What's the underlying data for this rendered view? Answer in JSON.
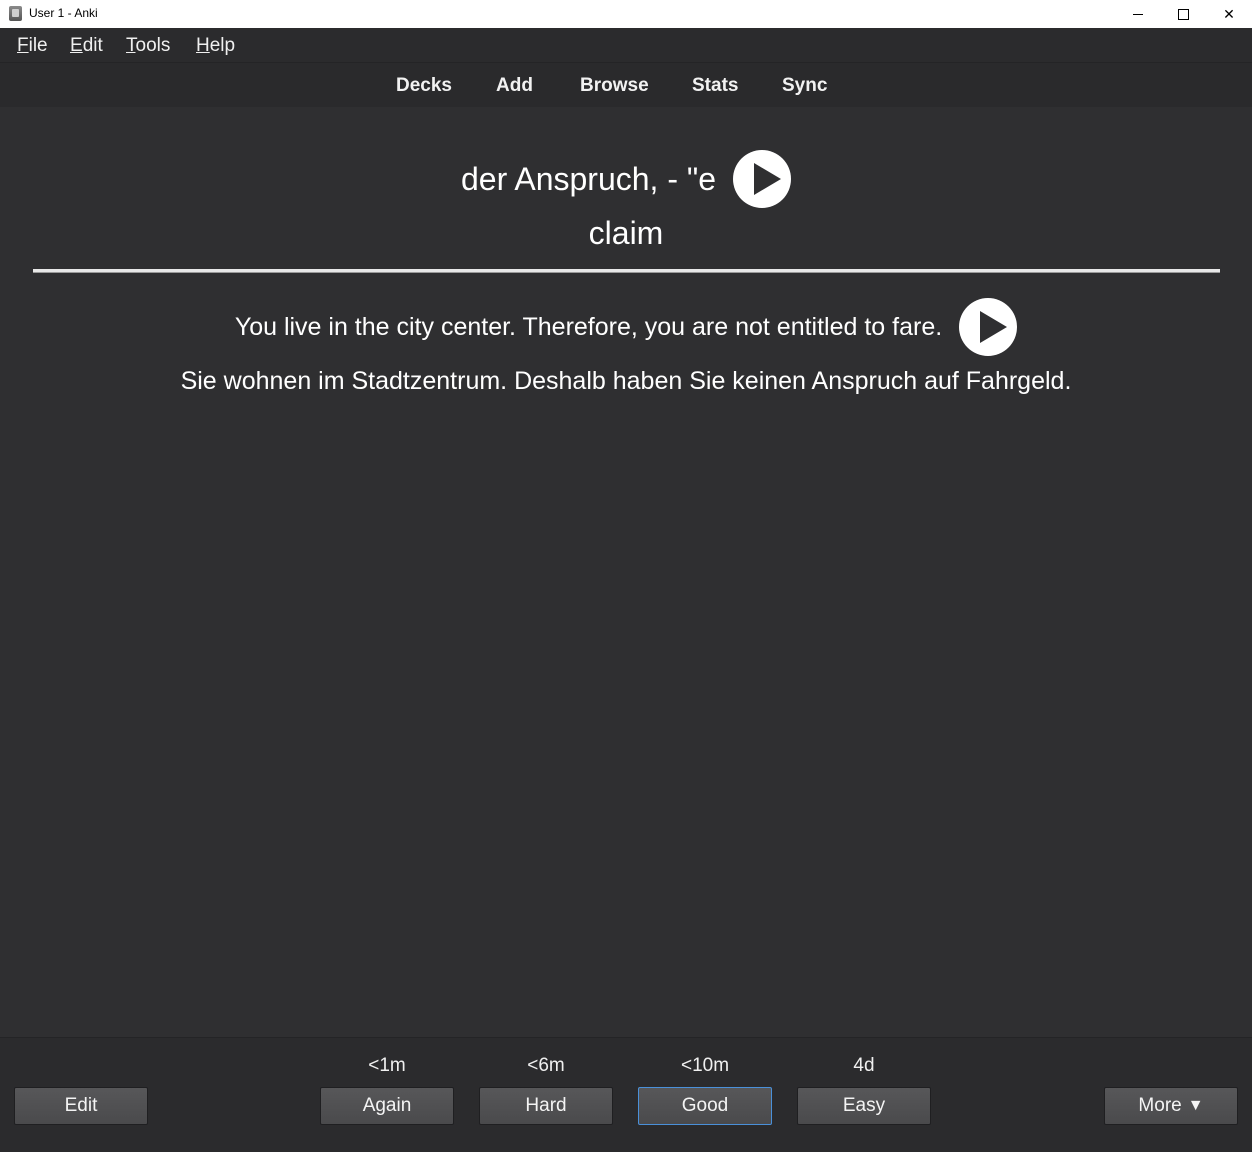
{
  "window": {
    "title": "User 1 - Anki",
    "controls": {
      "close": "✕"
    }
  },
  "menubar": {
    "items": [
      {
        "key": "F",
        "rest": "ile"
      },
      {
        "key": "E",
        "rest": "dit"
      },
      {
        "key": "T",
        "rest": "ools"
      },
      {
        "key": "H",
        "rest": "elp"
      }
    ]
  },
  "toolbar": {
    "items": [
      "Decks",
      "Add",
      "Browse",
      "Stats",
      "Sync"
    ]
  },
  "card": {
    "front": "der Anspruch, - \"e",
    "back": "claim",
    "example_en": "You live in the city center. Therefore, you are not entitled to fare.",
    "example_de": "Sie wohnen im Stadtzentrum. Deshalb haben Sie keinen Anspruch auf Fahrgeld."
  },
  "answer_bar": {
    "edit_label": "Edit",
    "buttons": [
      {
        "label": "Again",
        "interval": "<1m"
      },
      {
        "label": "Hard",
        "interval": "<6m"
      },
      {
        "label": "Good",
        "interval": "<10m",
        "focused": true
      },
      {
        "label": "Easy",
        "interval": "4d"
      }
    ],
    "more_label": "More",
    "more_arrow": "▼"
  },
  "icons": {
    "play": "play-icon",
    "app": "anki-icon"
  }
}
